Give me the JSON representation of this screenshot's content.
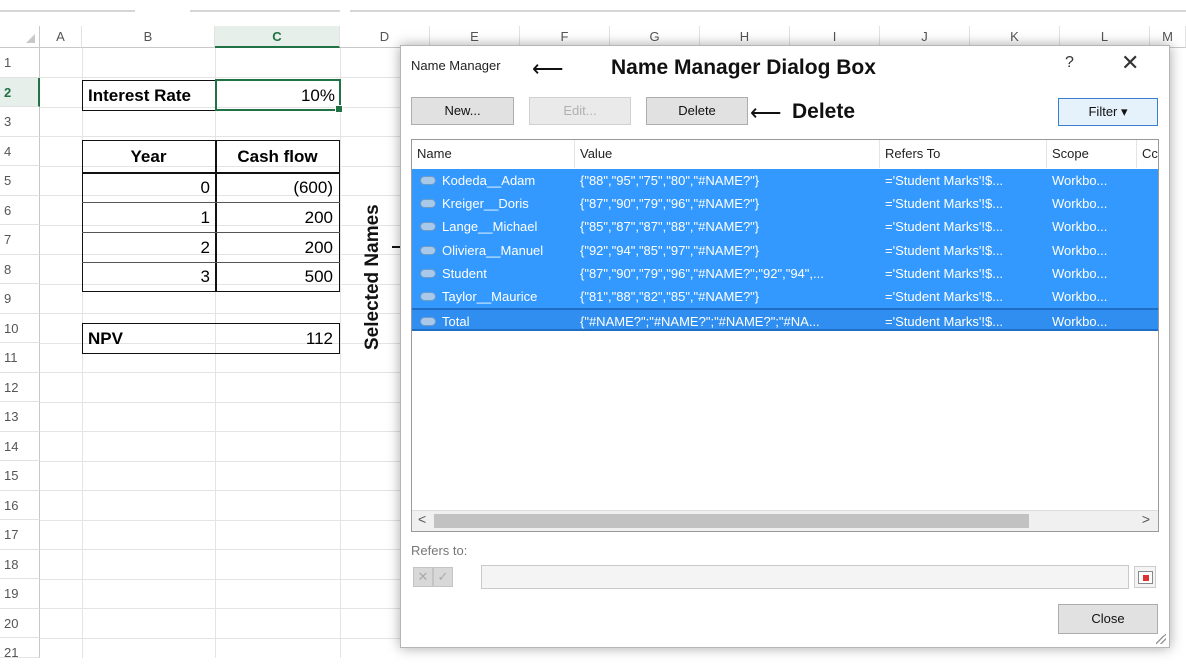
{
  "sheet": {
    "columns": [
      "A",
      "B",
      "C",
      "D",
      "E",
      "F",
      "G",
      "H",
      "I",
      "J",
      "K",
      "L",
      "M"
    ],
    "selected_column": "C",
    "rows": [
      "1",
      "2",
      "3",
      "4",
      "5",
      "6",
      "7",
      "8",
      "9",
      "10",
      "11",
      "12",
      "13",
      "14",
      "15",
      "16",
      "17",
      "18",
      "19",
      "20",
      "21"
    ],
    "selected_row": "2",
    "interest_rate_label": "Interest Rate",
    "interest_rate_value": "10%",
    "table_headers": [
      "Year",
      "Cash flow"
    ],
    "table_rows": [
      {
        "year": "0",
        "cash": "(600)"
      },
      {
        "year": "1",
        "cash": "200"
      },
      {
        "year": "2",
        "cash": "200"
      },
      {
        "year": "3",
        "cash": "500"
      }
    ],
    "npv_label": "NPV",
    "npv_value": "112"
  },
  "dialog": {
    "title": "Name Manager",
    "help": "?",
    "close_glyph": "✕",
    "buttons": {
      "new": "New...",
      "edit": "Edit...",
      "delete": "Delete",
      "filter": "Filter ▾",
      "close": "Close"
    },
    "list_headers": [
      "Name",
      "Value",
      "Refers To",
      "Scope",
      "Cc"
    ],
    "items": [
      {
        "name": "Kodeda__Adam",
        "value": "{\"88\",\"95\",\"75\",\"80\",\"#NAME?\"}",
        "refers": "='Student Marks'!$...",
        "scope": "Workbo..."
      },
      {
        "name": "Kreiger__Doris",
        "value": "{\"87\",\"90\",\"79\",\"96\",\"#NAME?\"}",
        "refers": "='Student Marks'!$...",
        "scope": "Workbo..."
      },
      {
        "name": "Lange__Michael",
        "value": "{\"85\",\"87\",\"87\",\"88\",\"#NAME?\"}",
        "refers": "='Student Marks'!$...",
        "scope": "Workbo..."
      },
      {
        "name": "Oliviera__Manuel",
        "value": "{\"92\",\"94\",\"85\",\"97\",\"#NAME?\"}",
        "refers": "='Student Marks'!$...",
        "scope": "Workbo..."
      },
      {
        "name": "Student",
        "value": "{\"87\",\"90\",\"79\",\"96\",\"#NAME?\";\"92\",\"94\",...",
        "refers": "='Student Marks'!$...",
        "scope": "Workbo..."
      },
      {
        "name": "Taylor__Maurice",
        "value": "{\"81\",\"88\",\"82\",\"85\",\"#NAME?\"}",
        "refers": "='Student Marks'!$...",
        "scope": "Workbo..."
      },
      {
        "name": "Total",
        "value": "{\"#NAME?\";\"#NAME?\";\"#NAME?\";\"#NA...",
        "refers": "='Student Marks'!$...",
        "scope": "Workbo..."
      }
    ],
    "refers_to_label": "Refers to:",
    "scroll_left": "<",
    "scroll_right": ">"
  },
  "annotations": {
    "dialog_label": "Name Manager Dialog Box",
    "delete_label": "Delete",
    "selected_names": "Selected Names",
    "arrow": "⟵"
  }
}
